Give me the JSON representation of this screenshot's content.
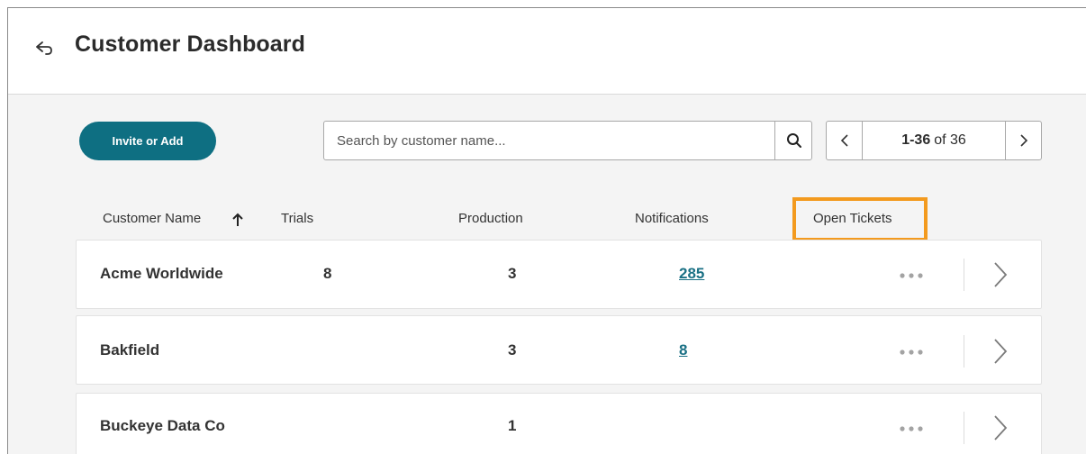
{
  "header": {
    "title": "Customer Dashboard",
    "back_icon": "back-arrow-icon"
  },
  "toolbar": {
    "invite_label": "Invite or Add",
    "search_placeholder": "Search by customer name...",
    "search_icon": "search-icon"
  },
  "pager": {
    "range": "1-36",
    "of_label": "of 36",
    "prev_icon": "chevron-left-icon",
    "next_icon": "chevron-right-icon"
  },
  "columns": {
    "customer_name": "Customer Name",
    "trials": "Trials",
    "production": "Production",
    "notifications": "Notifications",
    "open_tickets": "Open Tickets",
    "sort_direction": "ascending"
  },
  "highlight_color": "#f39a1e",
  "accent_color": "#0e6f82",
  "rows": [
    {
      "name": "Acme Worldwide",
      "trials": "8",
      "production": "3",
      "notifications": "285"
    },
    {
      "name": "Bakfield",
      "trials": "",
      "production": "3",
      "notifications": "8"
    },
    {
      "name": "Buckeye Data Co",
      "trials": "",
      "production": "1",
      "notifications": ""
    }
  ]
}
